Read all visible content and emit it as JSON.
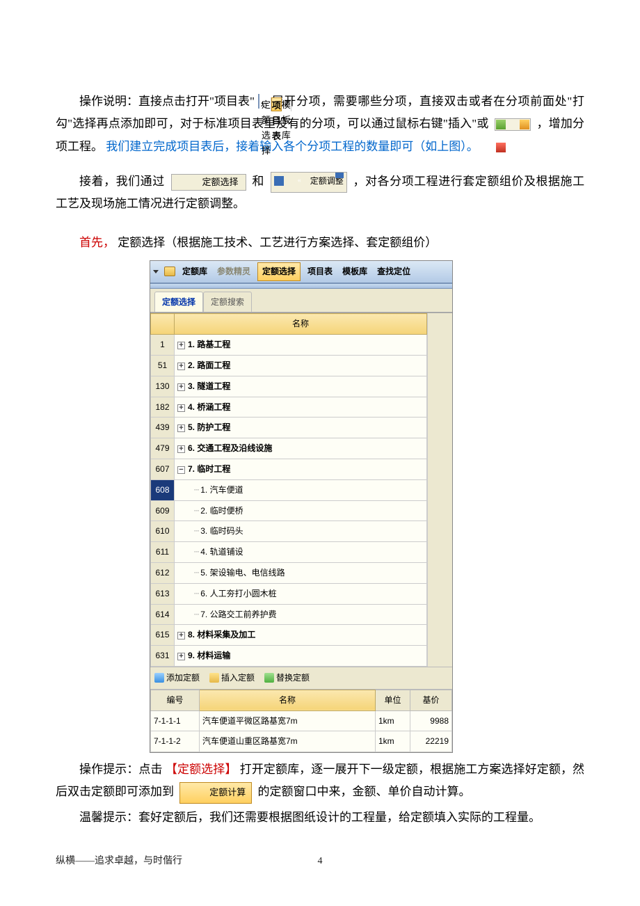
{
  "inline": {
    "tabs1": {
      "a": "定额选择",
      "b": "项目表",
      "c": "模板库"
    },
    "btn_select": "定额选择",
    "btn_adjust": "定额调整",
    "btn_calc": "定额计算"
  },
  "text": {
    "p1a": "操作说明：直接点击打开\"项目表\"",
    "p1b": "，展开分项，需要哪些分项，直接双击或者在分项前面处\"打勾\"选择再点添加即可，对于标准项目表里没有的分项，可以通过鼠标右键\"插入\"或",
    "p1c": "，增加分项工程。",
    "p1d": "我们建立完成项目表后，接着输入各个分项工程的数量即可（如上图）。",
    "p2a": "接着，我们通过",
    "p2b": "和",
    "p2c": "，对各分项工程进行套定额组价及根据施工工艺及现场施工情况进行定额调整。",
    "p3a": "首先，",
    "p3b": "定额选择（根据施工技术、工艺进行方案选择、套定额组价）",
    "p4a": "操作提示：点击",
    "p4b": "【定额选择】",
    "p4c": "打开定额库，逐一展开下一级定额，根据施工方案选择好定额，然后双击定额即可添加到",
    "p4d": "的定额窗口中来，金额、单价自动计算。",
    "p5": "温馨提示：套好定额后，我们还需要根据图纸设计的工程量，给定额填入实际的工程量。"
  },
  "shot": {
    "top": {
      "lib": "定额库",
      "wizard": "参数精灵",
      "select": "定额选择",
      "project": "项目表",
      "template": "模板库",
      "find": "查找定位"
    },
    "tabs": {
      "a": "定额选择",
      "b": "定额搜索"
    },
    "col_name": "名称",
    "tree": [
      {
        "num": "1",
        "label": "1. 路基工程",
        "expand": "+",
        "bold": true
      },
      {
        "num": "51",
        "label": "2. 路面工程",
        "expand": "+",
        "bold": true
      },
      {
        "num": "130",
        "label": "3. 隧道工程",
        "expand": "+",
        "bold": true
      },
      {
        "num": "182",
        "label": "4. 桥涵工程",
        "expand": "+",
        "bold": true
      },
      {
        "num": "439",
        "label": "5. 防护工程",
        "expand": "+",
        "bold": true
      },
      {
        "num": "479",
        "label": "6. 交通工程及沿线设施",
        "expand": "+",
        "bold": true
      },
      {
        "num": "607",
        "label": "7. 临时工程",
        "expand": "-",
        "bold": true
      },
      {
        "num": "608",
        "label": "1. 汽车便道",
        "child": true,
        "selected": true
      },
      {
        "num": "609",
        "label": "2. 临时便桥",
        "child": true
      },
      {
        "num": "610",
        "label": "3. 临时码头",
        "child": true
      },
      {
        "num": "611",
        "label": "4. 轨道铺设",
        "child": true
      },
      {
        "num": "612",
        "label": "5. 架设输电、电信线路",
        "child": true
      },
      {
        "num": "613",
        "label": "6. 人工夯打小圆木桩",
        "child": true
      },
      {
        "num": "614",
        "label": "7. 公路交工前养护费",
        "child": true
      },
      {
        "num": "615",
        "label": "8. 材料采集及加工",
        "expand": "+",
        "bold": true
      },
      {
        "num": "631",
        "label": "9. 材料运输",
        "expand": "+",
        "bold": true
      }
    ],
    "actions": {
      "add": "添加定额",
      "insert": "插入定额",
      "replace": "替换定额"
    },
    "grid2": {
      "h_code": "编号",
      "h_name": "名称",
      "h_unit": "单位",
      "h_price": "基价",
      "rows": [
        {
          "code": "7-1-1-1",
          "name": "汽车便道平微区路基宽7m",
          "unit": "1km",
          "price": "9988"
        },
        {
          "code": "7-1-1-2",
          "name": "汽车便道山重区路基宽7m",
          "unit": "1km",
          "price": "22219"
        }
      ]
    }
  },
  "footer": {
    "left": "纵横——追求卓越，与时偕行",
    "page": "4"
  }
}
